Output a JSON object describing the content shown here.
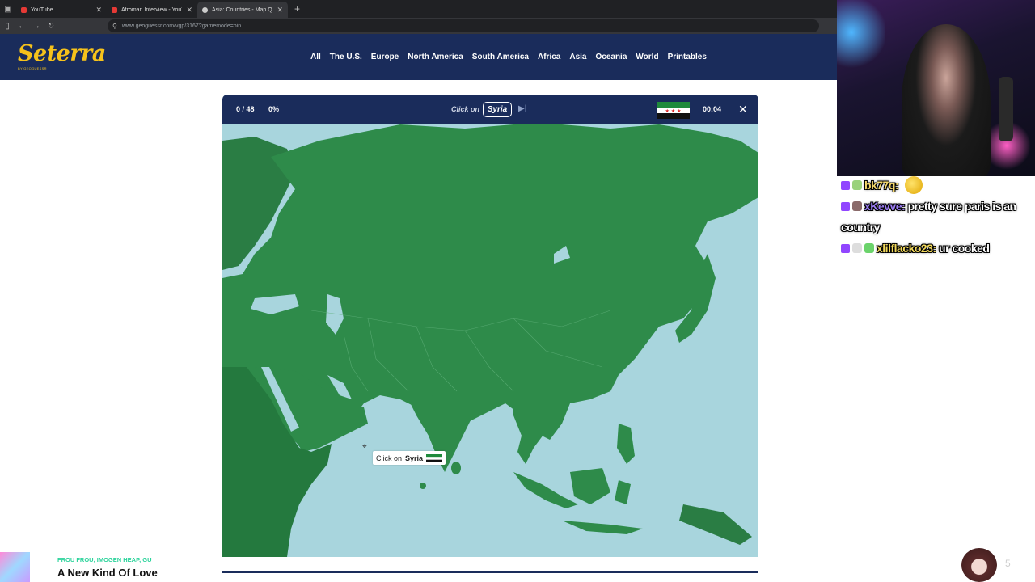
{
  "browser": {
    "tabs": [
      {
        "title": "YouTube",
        "active": false
      },
      {
        "title": "Afroman Interview - YouTube",
        "active": false
      },
      {
        "title": "Asia: Countries - Map Quiz Gar",
        "active": true
      }
    ],
    "url": "www.geoguessr.com/vgp/3167?gamemode=pin"
  },
  "site": {
    "logo": "Seterra",
    "logo_sub": "BY GEOGUESSR",
    "nav": [
      "All",
      "The U.S.",
      "Europe",
      "North America",
      "South America",
      "Africa",
      "Asia",
      "Oceania",
      "World",
      "Printables"
    ]
  },
  "quiz": {
    "score": "0 / 48",
    "percent": "0%",
    "prompt": "Click on",
    "target": "Syria",
    "timer": "00:04",
    "tooltip_text": "Click on",
    "tooltip_target": "Syria",
    "colors": {
      "land": "#2e8b4a",
      "sea": "#a8d5dd",
      "bar": "#1a2c5b"
    }
  },
  "chat": [
    {
      "user": "bk77q:",
      "message": ""
    },
    {
      "user": "xKevve:",
      "message": "pretty sure paris is an country"
    },
    {
      "user": "xlilflacko23:",
      "message": "ur cooked"
    }
  ],
  "music": {
    "artist": "FROU FROU, IMOGEN HEAP, GU",
    "song": "A New Kind Of Love"
  },
  "overlay_count": "5"
}
